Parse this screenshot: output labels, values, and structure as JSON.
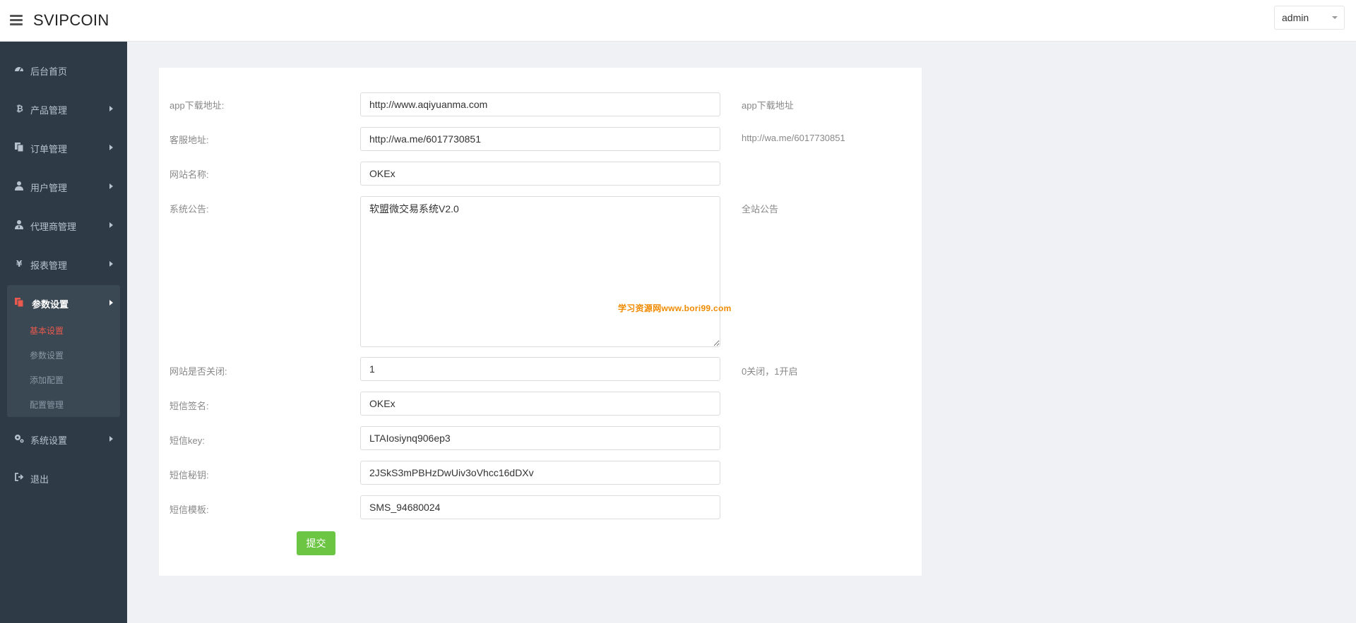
{
  "header": {
    "brand": "SVIPCOIN",
    "user": "admin"
  },
  "sidebar": {
    "items": [
      {
        "label": "后台首页",
        "icon": "dashboard-icon"
      },
      {
        "label": "产品管理",
        "icon": "bitcoin-icon"
      },
      {
        "label": "订单管理",
        "icon": "copy-icon"
      },
      {
        "label": "用户管理",
        "icon": "user-icon"
      },
      {
        "label": "代理商管理",
        "icon": "user-tie-icon"
      },
      {
        "label": "报表管理",
        "icon": "yen-icon"
      },
      {
        "label": "参数设置",
        "icon": "files-icon"
      },
      {
        "label": "系统设置",
        "icon": "gears-icon"
      },
      {
        "label": "退出",
        "icon": "sign-out-icon"
      }
    ],
    "sub_items": [
      {
        "label": "基本设置",
        "active": true
      },
      {
        "label": "参数设置"
      },
      {
        "label": "添加配置"
      },
      {
        "label": "配置管理"
      }
    ],
    "active_color": "#e9594d"
  },
  "form": {
    "rows": [
      {
        "label": "app下载地址:",
        "value": "http://www.aqiyuanma.com",
        "hint": "app下载地址"
      },
      {
        "label": "客服地址:",
        "value": "http://wa.me/6017730851",
        "hint": "http://wa.me/6017730851"
      },
      {
        "label": "网站名称:",
        "value": "OKEx",
        "hint": ""
      },
      {
        "label": "系统公告:",
        "value": "软盟微交易系统V2.0",
        "hint": "全站公告"
      },
      {
        "label": "网站是否关闭:",
        "value": "1",
        "hint": "0关闭，1开启"
      },
      {
        "label": "短信签名:",
        "value": "OKEx",
        "hint": ""
      },
      {
        "label": "短信key:",
        "value": "LTAIosiynq906ep3",
        "hint": ""
      },
      {
        "label": "短信秘钥:",
        "value": "2JSkS3mPBHzDwUiv3oVhcc16dDXv",
        "hint": ""
      },
      {
        "label": "短信模板:",
        "value": "SMS_94680024",
        "hint": ""
      }
    ],
    "submit_label": "提交"
  },
  "watermark": "学习资源网www.bori99.com",
  "colors": {
    "sidebar_bg": "#2e3b47",
    "submit": "#6cc644",
    "watermark": "#f08a00"
  }
}
